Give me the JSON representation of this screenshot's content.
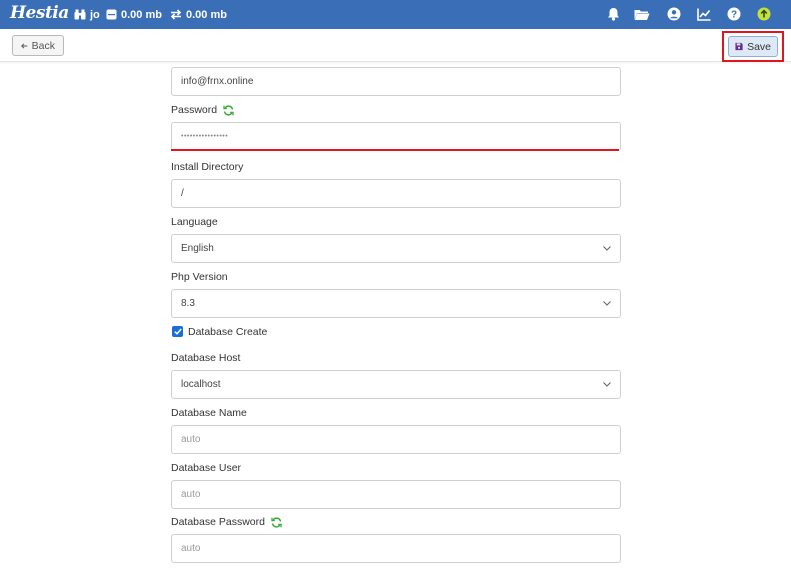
{
  "app": {
    "logo_text": "Hestia"
  },
  "topbar": {
    "user": "jo",
    "disk": "0.00 mb",
    "bandwidth": "0.00 mb",
    "icons": [
      "bell-icon",
      "folder-icon",
      "user-circle-icon",
      "stats-chart-icon",
      "help-icon",
      "update-arrow-icon"
    ]
  },
  "toolbar": {
    "back_label": "Back",
    "save_label": "Save"
  },
  "form": {
    "email_value": "info@frnx.online",
    "password_label": "Password",
    "password_value": "••••••••••••••••",
    "install_dir_label": "Install Directory",
    "install_dir_value": "/",
    "language_label": "Language",
    "language_value": "English",
    "php_label": "Php Version",
    "php_value": "8.3",
    "db_create_label": "Database Create",
    "db_create_checked": true,
    "db_host_label": "Database Host",
    "db_host_value": "localhost",
    "db_name_label": "Database Name",
    "db_name_placeholder": "auto",
    "db_user_label": "Database User",
    "db_user_placeholder": "auto",
    "db_password_label": "Database Password",
    "db_password_placeholder": "auto"
  },
  "colors": {
    "topbar": "#3a6fb7",
    "accent": "#1a6fd6",
    "highlight": "#e0161d",
    "refresh_icon": "#3aaa35"
  }
}
